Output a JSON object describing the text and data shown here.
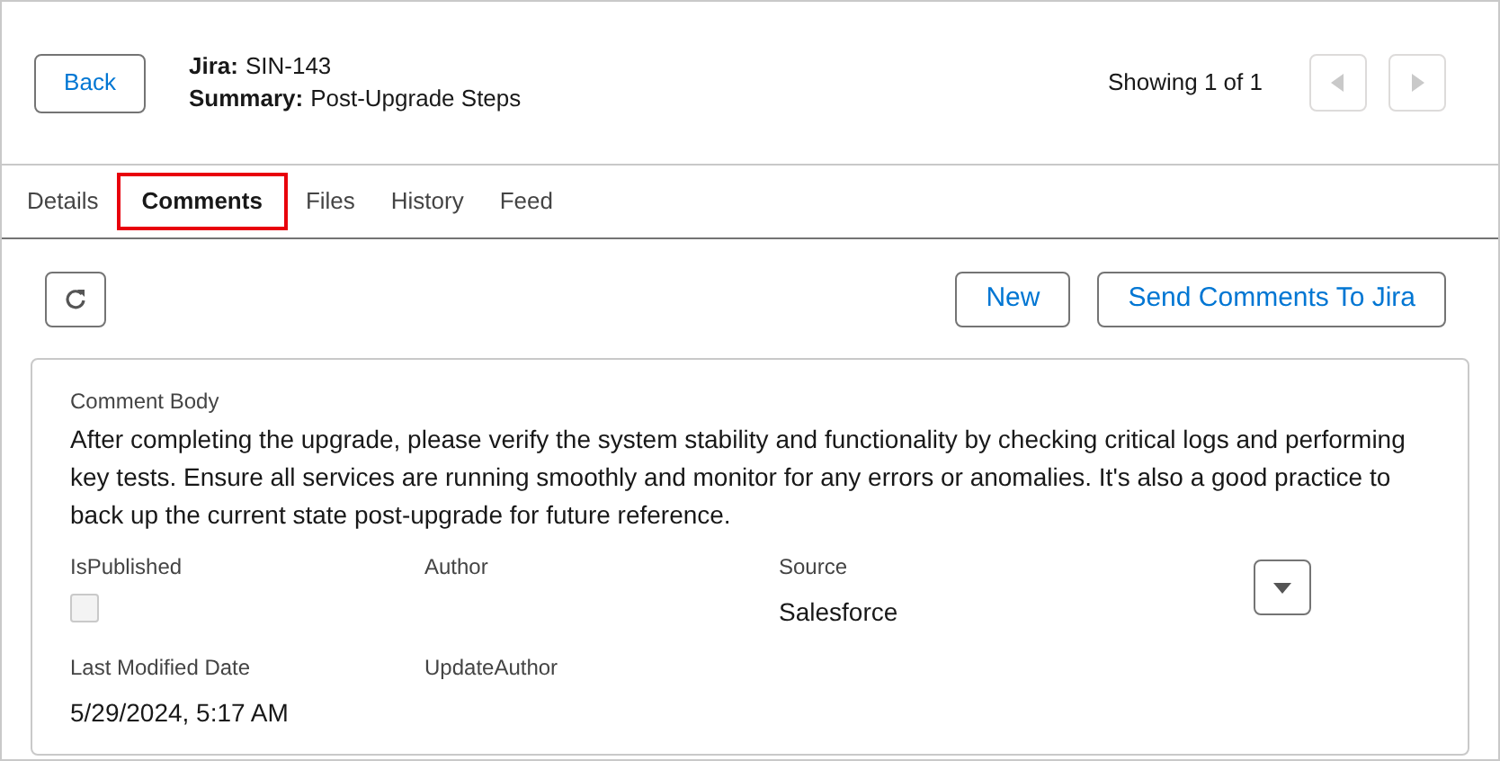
{
  "header": {
    "back_button": "Back",
    "jira_label": "Jira:",
    "jira_value": "SIN-143",
    "summary_label": "Summary:",
    "summary_value": "Post-Upgrade Steps",
    "paging": "Showing 1 of 1",
    "prev_disabled": true,
    "next_disabled": true
  },
  "tabs": [
    {
      "label": "Details",
      "selected": false
    },
    {
      "label": "Comments",
      "selected": true
    },
    {
      "label": "Files",
      "selected": false
    },
    {
      "label": "History",
      "selected": false
    },
    {
      "label": "Feed",
      "selected": false
    }
  ],
  "toolbar": {
    "buttons": [
      "New",
      "Send Comments To Jira"
    ]
  },
  "comment": {
    "body_label": "Comment Body",
    "body": "After completing the upgrade, please verify the system stability and functionality by checking critical logs and performing key tests. Ensure all services are running smoothly and monitor for any errors or anomalies. It's also a good practice to back up the current state post-upgrade for future reference.",
    "fields": [
      {
        "kind": "checkbox",
        "label": "IsPublished",
        "checked": false,
        "disabled": true
      },
      {
        "kind": "text",
        "label": "Author"
      },
      {
        "kind": "text",
        "label": "Source",
        "value": "Salesforce"
      },
      {
        "kind": "text",
        "label": "Last Modified Date",
        "value": "5/29/2024, 5:17 AM"
      },
      {
        "kind": "text",
        "label": "UpdateAuthor"
      }
    ]
  }
}
